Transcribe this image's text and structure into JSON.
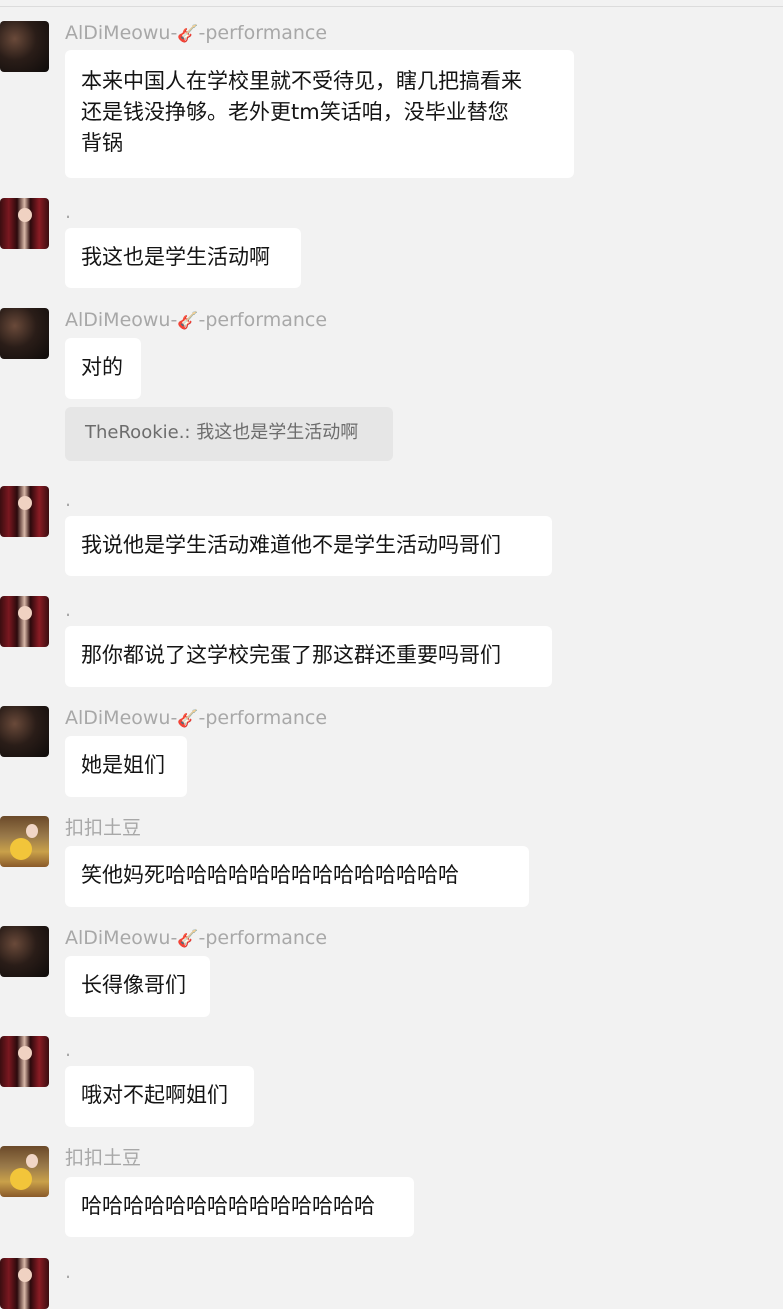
{
  "messages": [
    {
      "sender": "AlDiMeowu-",
      "sender_suffix": "-performance",
      "icon": "guitar-icon",
      "lines": [
        "本来中国人在学校里就不受待见，瞎几把搞看来",
        "还是钱没挣够。老外更tm笑话咱，没毕业替您",
        "背锅"
      ]
    },
    {
      "sender": ".",
      "lines": [
        "我这也是学生活动啊"
      ]
    },
    {
      "sender": "AlDiMeowu-",
      "sender_suffix": "-performance",
      "icon": "guitar-icon",
      "lines": [
        "对的"
      ],
      "quote": "TheRookie.: 我这也是学生活动啊"
    },
    {
      "sender": ".",
      "lines": [
        "我说他是学生活动难道他不是学生活动吗哥们"
      ]
    },
    {
      "sender": ".",
      "lines": [
        "那你都说了这学校完蛋了那这群还重要吗哥们"
      ]
    },
    {
      "sender": "AlDiMeowu-",
      "sender_suffix": "-performance",
      "icon": "guitar-icon",
      "lines": [
        "她是姐们"
      ]
    },
    {
      "sender": "扣扣土豆",
      "lines": [
        "笑他妈死哈哈哈哈哈哈哈哈哈哈哈哈哈哈"
      ]
    },
    {
      "sender": "AlDiMeowu-",
      "sender_suffix": "-performance",
      "icon": "guitar-icon",
      "lines": [
        "长得像哥们"
      ]
    },
    {
      "sender": ".",
      "lines": [
        "哦对不起啊姐们"
      ]
    },
    {
      "sender": "扣扣土豆",
      "lines": [
        "哈哈哈哈哈哈哈哈哈哈哈哈哈哈"
      ]
    },
    {
      "sender": "."
    }
  ]
}
